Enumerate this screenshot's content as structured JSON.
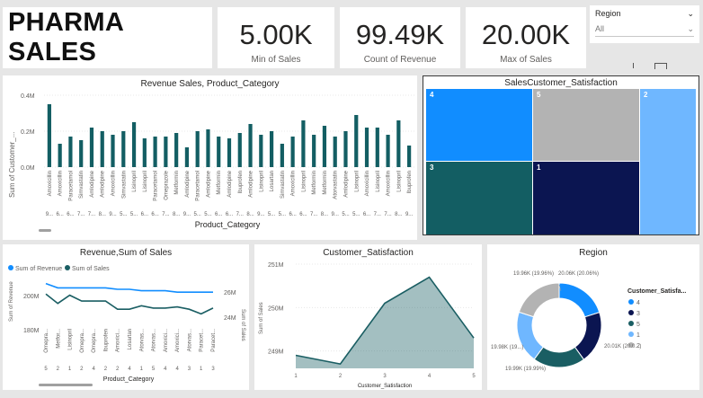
{
  "title": "PHARMA SALES",
  "kpis": [
    {
      "value": "5.00K",
      "label": "Min of Sales"
    },
    {
      "value": "99.49K",
      "label": "Count of Revenue"
    },
    {
      "value": "20.00K",
      "label": "Max of Sales"
    }
  ],
  "slicer": {
    "label": "Region",
    "selected": "All"
  },
  "visual_titles": {
    "bar": "Revenue Sales, Product_Category",
    "treemap": "SalesCustomer_Satisfaction",
    "combo": "Revenue,Sum of Sales",
    "area": "Customer_Satisfaction",
    "donut": "Region"
  },
  "colors": {
    "teal": "#1a5e63",
    "blue": "#118dff",
    "navy": "#0b1551",
    "gray": "#b3b3b3",
    "lightblue": "#6fb7ff"
  },
  "chart_data": [
    {
      "type": "bar",
      "title": "Revenue Sales, Product_Category",
      "xlabel": "Product_Category",
      "ylabel": "Sum of Customer_...",
      "ylim": [
        0,
        0.4
      ],
      "ytick_labels": [
        "0.0M",
        "0.2M",
        "0.4M"
      ],
      "categories": [
        "Amoxicillin",
        "Amoxicillin",
        "Paracetamol",
        "Simvastatin",
        "Amlodipine",
        "Amlodipine",
        "Amoxicillin",
        "Simvastatin",
        "Lisinopril",
        "Lisinopril",
        "Paracetamol",
        "Omeprazole",
        "Metformin",
        "Amlodipine",
        "Paracetamol",
        "Amlodipine",
        "Metformin",
        "Amlodipine",
        "Ibuprofen",
        "Amlodipine",
        "Lisinopril",
        "Losartan",
        "Simvastatin",
        "Amoxicillin",
        "Lisinopril",
        "Metformin",
        "Metformin",
        "Atorvastatin",
        "Amlodipine",
        "Lisinopril",
        "Amoxicillin",
        "Lisinopril",
        "Amoxicillin",
        "Lisinopril",
        "Ibuprofen"
      ],
      "sublabels": [
        "9...",
        "6...",
        "6...",
        "7...",
        "7...",
        "8...",
        "9...",
        "5...",
        "5...",
        "6...",
        "6...",
        "7...",
        "8...",
        "9...",
        "5...",
        "5...",
        "6...",
        "6...",
        "7...",
        "8...",
        "9...",
        "5...",
        "5...",
        "6...",
        "6...",
        "7...",
        "8...",
        "9...",
        "5...",
        "5...",
        "6...",
        "7...",
        "7...",
        "8...",
        "9..."
      ],
      "values": [
        0.35,
        0.13,
        0.17,
        0.15,
        0.22,
        0.2,
        0.18,
        0.2,
        0.25,
        0.16,
        0.17,
        0.17,
        0.19,
        0.11,
        0.2,
        0.21,
        0.17,
        0.16,
        0.19,
        0.24,
        0.18,
        0.2,
        0.13,
        0.17,
        0.26,
        0.18,
        0.23,
        0.17,
        0.2,
        0.29,
        0.22,
        0.22,
        0.18,
        0.26,
        0.12
      ]
    },
    {
      "type": "treemap",
      "title": "SalesCustomer_Satisfaction",
      "labels": [
        "4",
        "5",
        "2",
        "3",
        "1"
      ]
    },
    {
      "type": "line",
      "title": "Revenue,Sum of Sales",
      "xlabel": "Product_Category",
      "ylabel": "Sum of Revenue",
      "ylabel2": "Sum of Sales",
      "legend": [
        "Sum of Revenue",
        "Sum of Sales"
      ],
      "ytick_labels": [
        "180M",
        "200M"
      ],
      "ytick_labels2": [
        "24M",
        "26M"
      ],
      "categories": [
        "Omepra...",
        "Metfor...",
        "Lisinopril",
        "Omepra...",
        "Omepra...",
        "Ibuprofen",
        "Amoxici...",
        "Losartan",
        "Atorvas...",
        "Atorvas...",
        "Amoxici...",
        "Amoxici...",
        "Atorvas...",
        "Paracet...",
        "Paracet..."
      ],
      "sublabels": [
        "5",
        "2",
        "1",
        "2",
        "4",
        "2",
        "2",
        "4",
        "1",
        "5",
        "4",
        "4",
        "3",
        "1",
        "3"
      ],
      "series": [
        {
          "name": "Sum of Revenue",
          "values": [
            209,
            206,
            206,
            206,
            206,
            206,
            205,
            205,
            204,
            204,
            204,
            203,
            203,
            203,
            203
          ]
        },
        {
          "name": "Sum of Sales",
          "values": [
            25.9,
            25.1,
            25.8,
            25.3,
            25.3,
            25.3,
            24.6,
            24.6,
            24.9,
            24.7,
            24.7,
            24.8,
            24.6,
            24.2,
            24.7
          ]
        }
      ]
    },
    {
      "type": "area",
      "title": "Customer_Satisfaction",
      "xlabel": "Customer_Satisfaction",
      "ylabel": "Sum of Sales",
      "x": [
        1,
        2,
        3,
        4,
        5
      ],
      "values": [
        248.9,
        248.7,
        250.1,
        250.7,
        249.3
      ],
      "ylim": [
        248.6,
        251
      ],
      "ytick_labels": [
        "249M",
        "250M",
        "251M"
      ]
    },
    {
      "type": "pie",
      "title": "Region",
      "legend_title": "Customer_Satisfa...",
      "legend": [
        "4",
        "3",
        "5",
        "1",
        "2"
      ],
      "values": [
        20.06,
        20.03,
        19.99,
        19.98,
        19.96
      ],
      "slice_labels": [
        "20.06K (20.06%)",
        "20.01K (20.0...)",
        "19.99K (19.99%)",
        "19.98K (19...)",
        "19.96K (19.96%)"
      ]
    }
  ]
}
